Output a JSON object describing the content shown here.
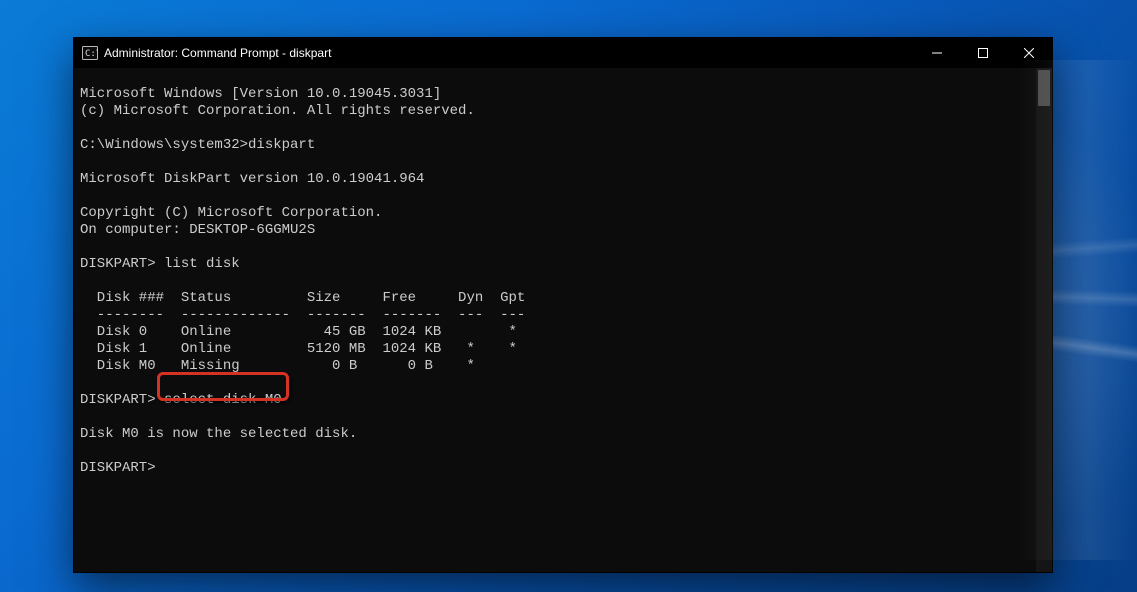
{
  "window": {
    "title": "Administrator: Command Prompt - diskpart"
  },
  "console": {
    "lines": [
      "Microsoft Windows [Version 10.0.19045.3031]",
      "(c) Microsoft Corporation. All rights reserved.",
      "",
      "C:\\Windows\\system32>diskpart",
      "",
      "Microsoft DiskPart version 10.0.19041.964",
      "",
      "Copyright (C) Microsoft Corporation.",
      "On computer: DESKTOP-6GGMU2S",
      "",
      "DISKPART> list disk",
      "",
      "  Disk ###  Status         Size     Free     Dyn  Gpt",
      "  --------  -------------  -------  -------  ---  ---",
      "  Disk 0    Online           45 GB  1024 KB        *",
      "  Disk 1    Online         5120 MB  1024 KB   *    *",
      "  Disk M0   Missing           0 B      0 B    *",
      "",
      "DISKPART> select disk M0",
      "",
      "Disk M0 is now the selected disk.",
      "",
      "DISKPART>"
    ],
    "highlight": {
      "text": "select disk M0",
      "line_index": 18
    }
  },
  "colors": {
    "console_bg": "#0c0c0c",
    "console_fg": "#cccccc",
    "callout_border": "#d53224",
    "desktop_primary": "#0a6bd1"
  }
}
